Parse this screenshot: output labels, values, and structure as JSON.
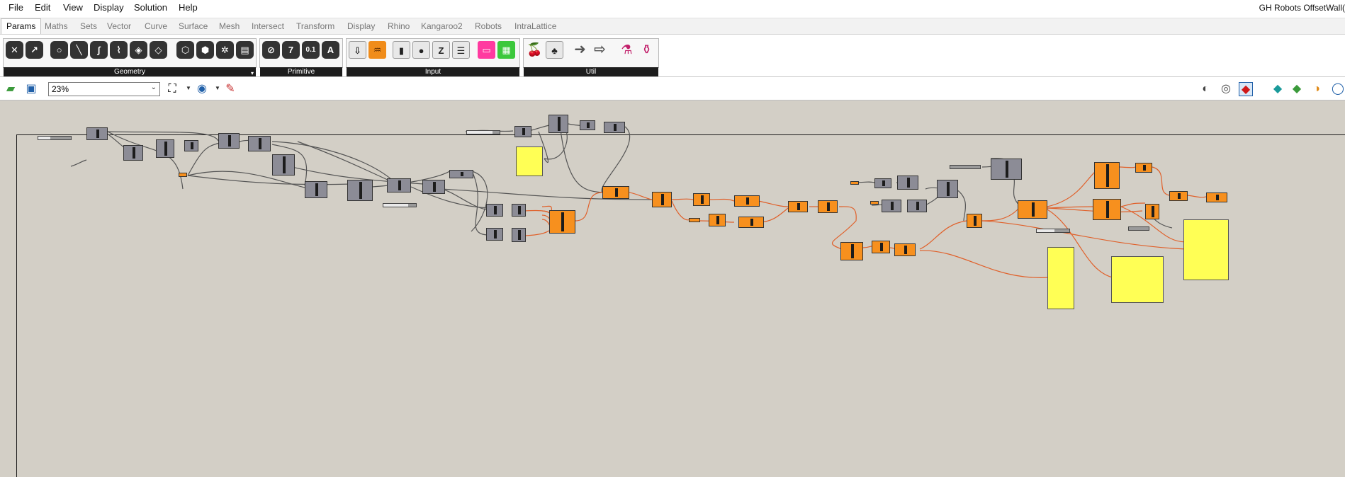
{
  "menubar": {
    "items": [
      "File",
      "Edit",
      "View",
      "Display",
      "Solution",
      "Help"
    ],
    "document_title": "GH Robots OffsetWall("
  },
  "tabs": [
    "Params",
    "Maths",
    "Sets",
    "Vector",
    "Curve",
    "Surface",
    "Mesh",
    "Intersect",
    "Transform",
    "Display",
    "Rhino",
    "Kangaroo2",
    "Robots",
    "IntraLattice"
  ],
  "active_tab": "Params",
  "ribbon": {
    "panels": [
      {
        "label": "Geometry"
      },
      {
        "label": "Primitive"
      },
      {
        "label": "Input"
      },
      {
        "label": "Util"
      }
    ],
    "primitive_glyphs": [
      "7",
      "0.1",
      "A"
    ]
  },
  "toolbar": {
    "zoom": "23%"
  },
  "colors": {
    "canvas": "#d3cfc6",
    "component_grey": "#8c8c96",
    "component_selected": "#f7901e",
    "panel_yellow": "#ffff55",
    "wire_selected": "#e0602a",
    "wire_default": "#555555"
  }
}
